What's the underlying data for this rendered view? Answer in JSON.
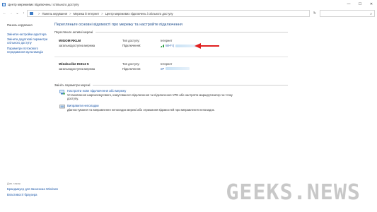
{
  "window": {
    "title": "Центр мережевих підключень і спільного доступу",
    "controls": {
      "minimize": "—",
      "maximize": "☐",
      "close": "✕"
    }
  },
  "nav": {
    "back": "←",
    "forward": "→",
    "up_recent": "⌄",
    "up": "↑",
    "refresh": "↻",
    "breadcrumb": [
      "Панель керування",
      "Мережа й Інтернет",
      "Центр мережевих підключень і спільного доступу"
    ],
    "breadcrumb_sep": ">",
    "search_placeholder": ""
  },
  "sidebar": {
    "home": "Панель керування",
    "links": [
      "Змінити настройки адаптера",
      "Змінити додаткові параметри спільного доступу",
      "Параметри потокового передавання мультимедіа"
    ]
  },
  "seealso": {
    "header": "Див. також",
    "links": [
      "Брандмауер для Захисника Windows",
      "Властивості браузера"
    ]
  },
  "main": {
    "title": "Перегляньте основні відомості про мережу та настройте підключення",
    "active_header": "Перегляньте активні мережі",
    "networks": [
      {
        "name": "WIGOM RKLM",
        "type": "загальнодоступна мережа",
        "access_label": "Тип доступу:",
        "access_value": "Інтернет",
        "conn_label": "Підключення:",
        "conn_value": "Wi-Fi ("
      },
      {
        "name": "Windscribe IKEv2 5",
        "type": "загальнодоступна мережа",
        "access_label": "Тип доступу:",
        "access_value": "Інтернет",
        "conn_label": "Підключення:",
        "conn_value": "нP"
      }
    ],
    "change_header": "Змініть параметри мережі",
    "tasks": [
      {
        "link": "Настроїти нове підключення або мережу",
        "desc": "Установлення широкосмугового, комутованого підключення чи підключення VPN або настроїти маршрутизатор чи точку доступу."
      },
      {
        "link": "Виправити неполадки",
        "desc": "Діагностування та виправлення неполадок мережі або отримання відомостей про виправлення неполадок."
      }
    ]
  },
  "watermark": {
    "text": "GEEKS.NEWS"
  },
  "colors": {
    "link": "#1a56a8",
    "title": "#1f4e8c",
    "arrow": "#e02020",
    "wifi": "#2ea043"
  }
}
